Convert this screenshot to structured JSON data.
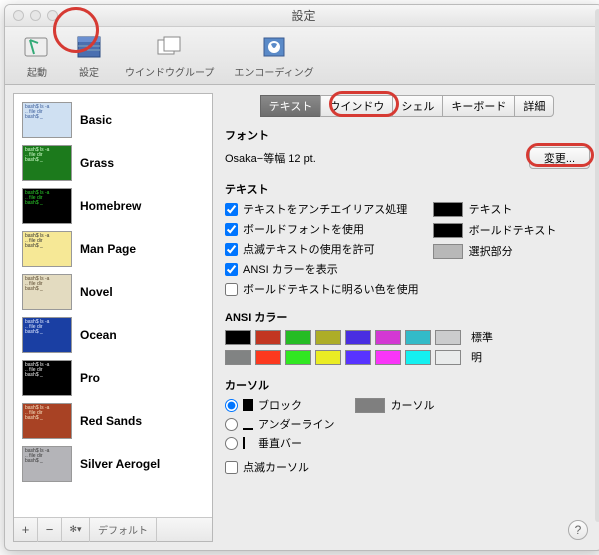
{
  "title": "設定",
  "toolbar": [
    {
      "id": "startup",
      "label": "起動"
    },
    {
      "id": "settings",
      "label": "設定"
    },
    {
      "id": "wingroup",
      "label": "ウインドウグループ"
    },
    {
      "id": "encoding",
      "label": "エンコーディング"
    }
  ],
  "profiles": [
    {
      "name": "Basic",
      "bg": "#cfe0f2",
      "fg": "#3a5c9a"
    },
    {
      "name": "Grass",
      "bg": "#1c7a1c",
      "fg": "#d0ffcc"
    },
    {
      "name": "Homebrew",
      "bg": "#000000",
      "fg": "#2bd12b"
    },
    {
      "name": "Man Page",
      "bg": "#f6e896",
      "fg": "#333"
    },
    {
      "name": "Novel",
      "bg": "#e3dbc0",
      "fg": "#5b4a30"
    },
    {
      "name": "Ocean",
      "bg": "#1a3fa3",
      "fg": "#dfe8ff"
    },
    {
      "name": "Pro",
      "bg": "#000000",
      "fg": "#eaeaea"
    },
    {
      "name": "Red Sands",
      "bg": "#a84224",
      "fg": "#f4e0c0"
    },
    {
      "name": "Silver Aerogel",
      "bg": "#b4b4b8",
      "fg": "#3a3a3a"
    }
  ],
  "sidebarFooter": {
    "add": "+",
    "remove": "−",
    "gear": "✻▾",
    "default": "デフォルト"
  },
  "tabs": [
    "テキスト",
    "ウインドウ",
    "シェル",
    "キーボード",
    "詳細"
  ],
  "font": {
    "title": "フォント",
    "desc": "Osaka−等幅 12 pt.",
    "change": "変更..."
  },
  "text": {
    "title": "テキスト",
    "opts": [
      {
        "label": "テキストをアンチエイリアス処理",
        "checked": true
      },
      {
        "label": "ボールドフォントを使用",
        "checked": true
      },
      {
        "label": "点滅テキストの使用を許可",
        "checked": true
      },
      {
        "label": "ANSI カラーを表示",
        "checked": true
      },
      {
        "label": "ボールドテキストに明るい色を使用",
        "checked": false
      }
    ],
    "swatches": [
      {
        "label": "テキスト",
        "color": "#000000"
      },
      {
        "label": "ボールドテキスト",
        "color": "#000000"
      },
      {
        "label": "選択部分",
        "color": "#b8b8b8"
      }
    ]
  },
  "ansi": {
    "title": "ANSI カラー",
    "rows": [
      {
        "label": "標準",
        "colors": [
          "#000000",
          "#c23621",
          "#25bc24",
          "#adad27",
          "#492ee1",
          "#d338d3",
          "#33bbc8",
          "#cbcccd"
        ]
      },
      {
        "label": "明",
        "colors": [
          "#818383",
          "#fc391f",
          "#31e722",
          "#eaec23",
          "#5833ff",
          "#f935f8",
          "#14f0f0",
          "#e9ebeb"
        ]
      }
    ]
  },
  "cursor": {
    "title": "カーソル",
    "radios": [
      "ブロック",
      "アンダーライン",
      "垂直バー"
    ],
    "blink": "点滅カーソル",
    "swatch": {
      "label": "カーソル",
      "color": "#7f7f7f"
    }
  },
  "help": "?"
}
